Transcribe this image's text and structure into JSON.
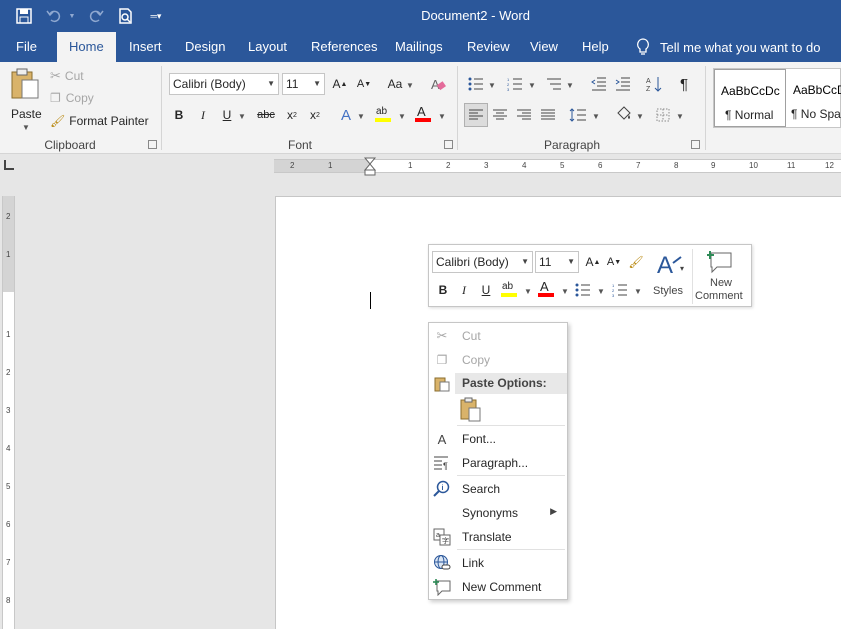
{
  "window": {
    "title": "Document2 - Word"
  },
  "tabs": [
    "File",
    "Home",
    "Insert",
    "Design",
    "Layout",
    "References",
    "Mailings",
    "Review",
    "View",
    "Help"
  ],
  "active_tab": "Home",
  "tell_me": "Tell me what you want to do",
  "ribbon": {
    "clipboard": {
      "paste": "Paste",
      "cut": "Cut",
      "copy": "Copy",
      "format_painter": "Format Painter",
      "label": "Clipboard"
    },
    "font": {
      "font_name": "Calibri (Body)",
      "font_size": "11",
      "change_case": "Aa",
      "label": "Font"
    },
    "paragraph": {
      "label": "Paragraph"
    },
    "styles": [
      {
        "preview": "AaBbCcDc",
        "name": "¶ Normal"
      },
      {
        "preview": "AaBbCcDc",
        "name": "¶ No Spac..."
      }
    ]
  },
  "hruler": [
    "2",
    "1",
    "1",
    "2",
    "3",
    "4",
    "5",
    "6",
    "7",
    "8",
    "9",
    "10",
    "11",
    "12"
  ],
  "vruler": [
    "2",
    "1",
    "1",
    "2",
    "3",
    "4",
    "5",
    "6",
    "7",
    "8"
  ],
  "mini_toolbar": {
    "font_name": "Calibri (Body)",
    "font_size": "11",
    "styles": "Styles",
    "new_comment_1": "New",
    "new_comment_2": "Comment"
  },
  "context_menu": {
    "cut": "Cut",
    "copy": "Copy",
    "paste_options": "Paste Options:",
    "font": "Font...",
    "paragraph": "Paragraph...",
    "search": "Search",
    "synonyms": "Synonyms",
    "translate": "Translate",
    "link": "Link",
    "new_comment": "New Comment"
  },
  "colors": {
    "accent": "#2b579a",
    "highlight": "#ffff00",
    "font_color": "#ff0000"
  }
}
